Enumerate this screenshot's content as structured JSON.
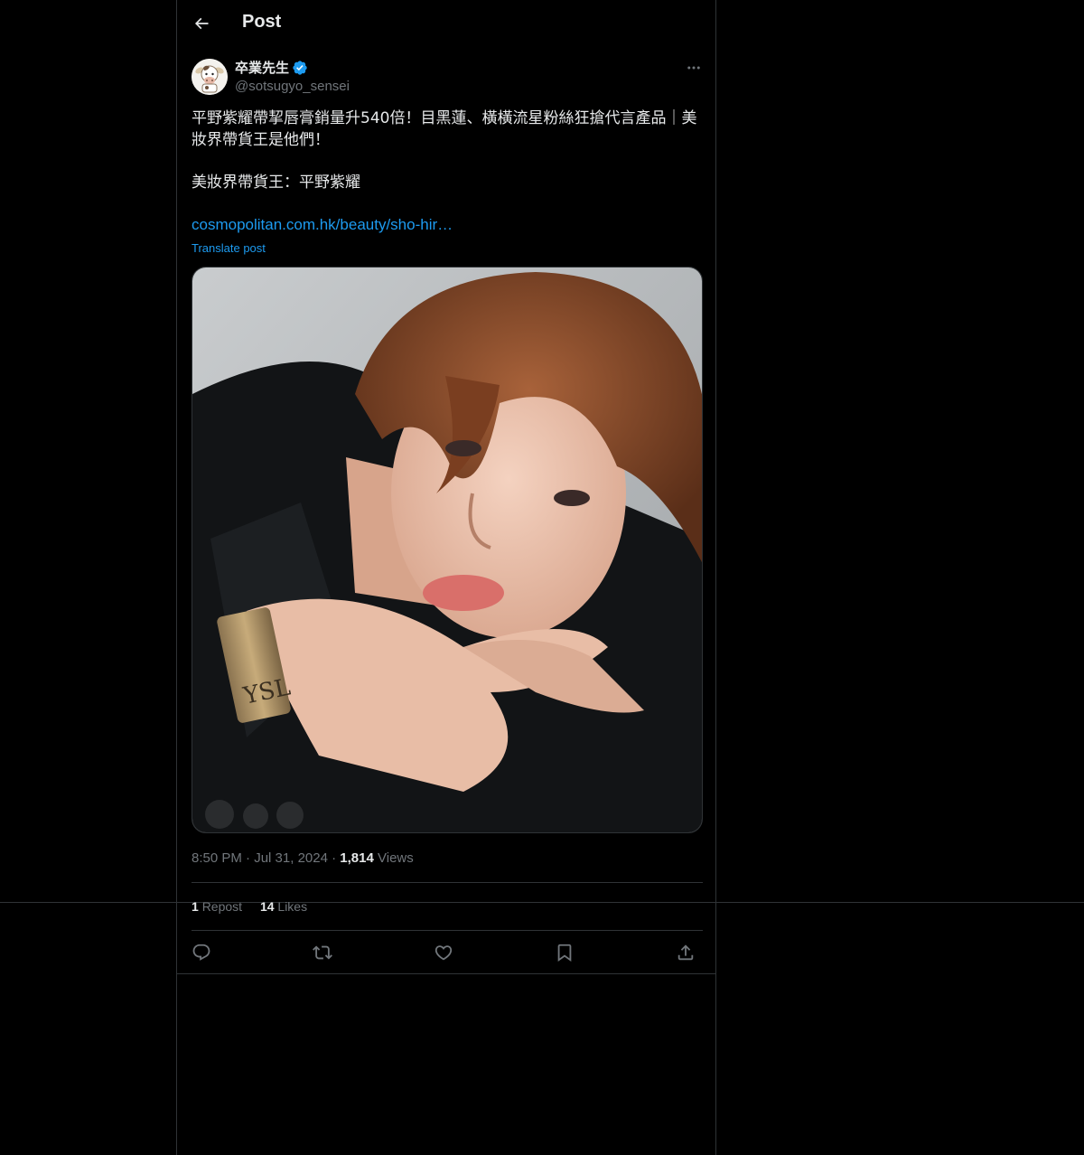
{
  "header": {
    "back_icon": "arrow-left-icon",
    "title": "Post"
  },
  "author": {
    "display_name": "卒業先生",
    "verified_icon": "verified-badge-icon",
    "handle": "@sotsugyo_sensei",
    "avatar_icon": "cow-avatar"
  },
  "more_icon": "more-dots-icon",
  "tweet": {
    "line1": "平野紫耀帶挈唇膏銷量升540倍！目黑蓮、橫橫流星粉絲狂搶代言產品｜美",
    "line2": "妝界帶貨王是他們！",
    "line3": "美妝界帶貨王：平野紫耀",
    "link": "cosmopolitan.com.hk/beauty/sho-hir…",
    "translate": "Translate post"
  },
  "meta": {
    "time": "8:50 PM",
    "date": "Jul 31, 2024",
    "views_count": "1,814",
    "views_label": "Views"
  },
  "stats": {
    "reposts_count": "1",
    "reposts_label": "Repost",
    "likes_count": "14",
    "likes_label": "Likes"
  },
  "actions": [
    "reply-icon",
    "repost-icon",
    "like-icon",
    "bookmark-icon",
    "share-icon"
  ],
  "colors": {
    "background": "#000000",
    "text": "#e7e9ea",
    "secondary": "#71767b",
    "accent": "#1d9bf0",
    "border": "#2f3336"
  }
}
